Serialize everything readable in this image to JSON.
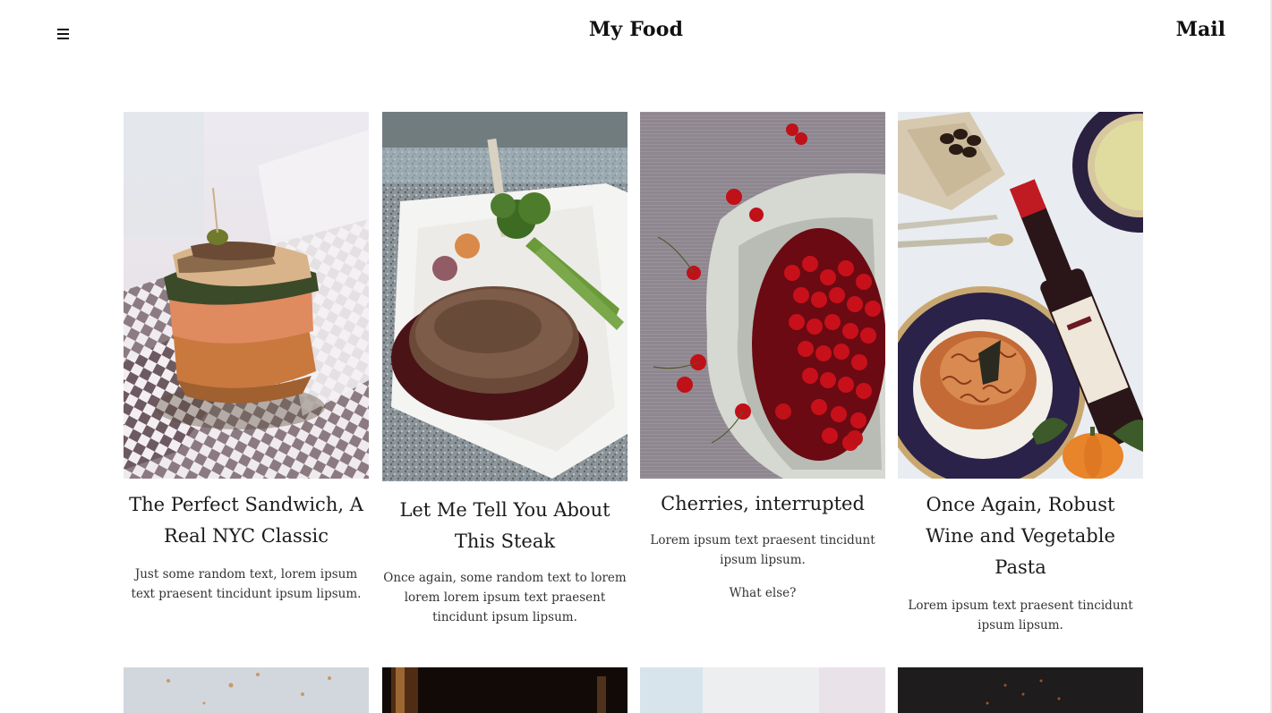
{
  "header": {
    "menu_icon": "hamburger-menu-icon",
    "title": "My Food",
    "mail_label": "Mail"
  },
  "posts": [
    {
      "title": "The Perfect Sandwich, A Real NYC Classic",
      "excerpt": [
        "Just some random text, lorem ipsum text praesent tincidunt ipsum lipsum."
      ],
      "image": "sandwich-photo"
    },
    {
      "title": "Let Me Tell You About This Steak",
      "excerpt": [
        "Once again, some random text to lorem lorem lorem ipsum text praesent tincidunt ipsum lipsum."
      ],
      "image": "steak-photo"
    },
    {
      "title": "Cherries, interrupted",
      "excerpt": [
        "Lorem ipsum text praesent tincidunt ipsum lipsum.",
        "What else?"
      ],
      "image": "cherries-photo"
    },
    {
      "title": "Once Again, Robust Wine and Vegetable Pasta",
      "excerpt": [
        "Lorem ipsum text praesent tincidunt ipsum lipsum."
      ],
      "image": "wine-pasta-photo"
    }
  ],
  "colors": {
    "text": "#111111",
    "background": "#ffffff"
  }
}
